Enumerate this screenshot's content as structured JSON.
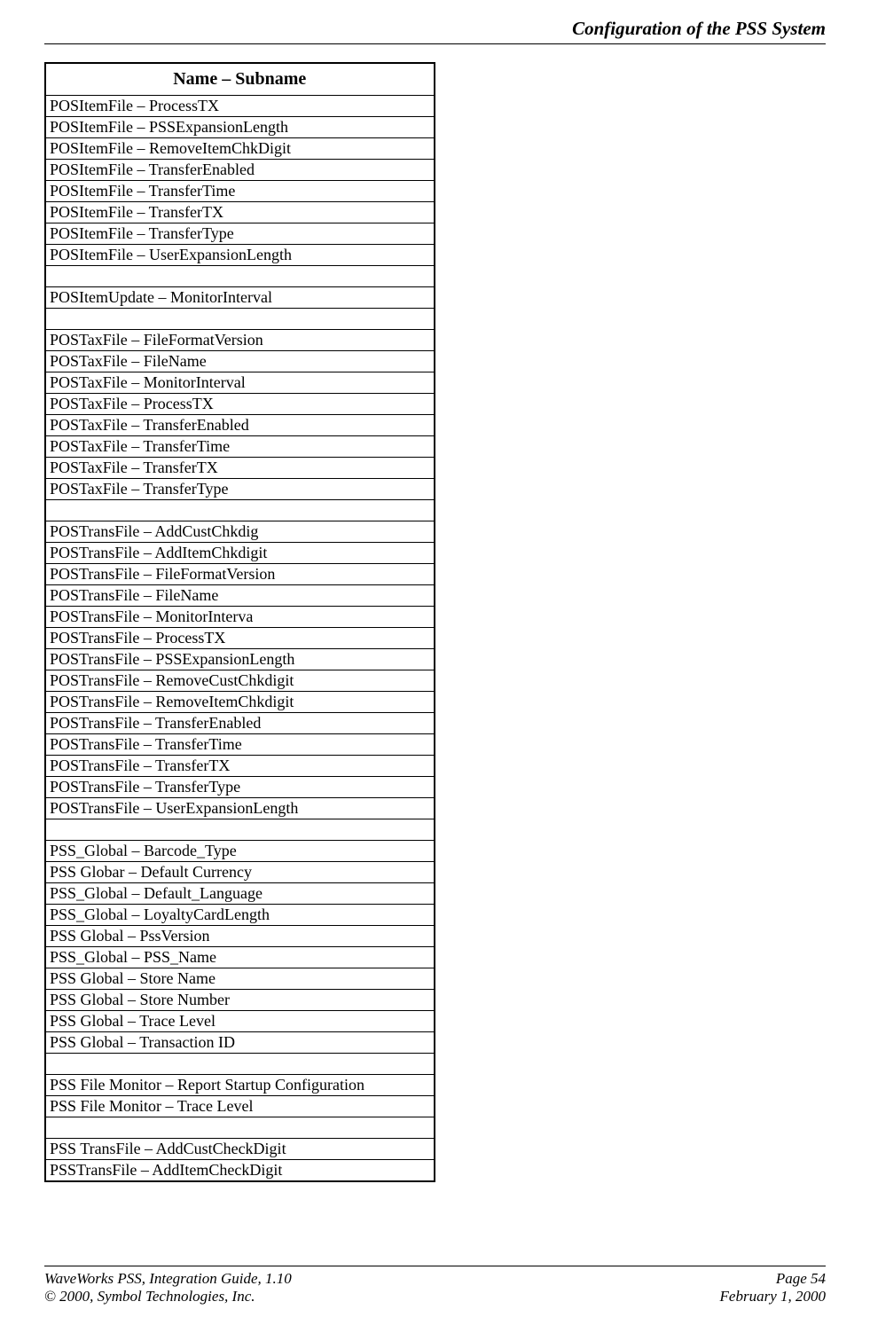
{
  "header": {
    "title": "Configuration of the PSS System"
  },
  "table": {
    "header": "Name – Subname",
    "rows": [
      "POSItemFile – ProcessTX",
      "POSItemFile – PSSExpansionLength",
      "POSItemFile – RemoveItemChkDigit",
      "POSItemFile – TransferEnabled",
      "POSItemFile – TransferTime",
      "POSItemFile – TransferTX",
      "POSItemFile – TransferType",
      "POSItemFile – UserExpansionLength",
      "",
      "POSItemUpdate – MonitorInterval",
      "",
      "POSTaxFile – FileFormatVersion",
      "POSTaxFile – FileName",
      "POSTaxFile – MonitorInterval",
      "POSTaxFile – ProcessTX",
      "POSTaxFile – TransferEnabled",
      "POSTaxFile – TransferTime",
      "POSTaxFile – TransferTX",
      "POSTaxFile – TransferType",
      "",
      "POSTransFile – AddCustChkdig",
      "POSTransFile – AddItemChkdigit",
      "POSTransFile – FileFormatVersion",
      "POSTransFile – FileName",
      "POSTransFile – MonitorInterva",
      "POSTransFile – ProcessTX",
      "POSTransFile – PSSExpansionLength",
      "POSTransFile – RemoveCustChkdigit",
      "POSTransFile – RemoveItemChkdigit",
      "POSTransFile – TransferEnabled",
      "POSTransFile – TransferTime",
      "POSTransFile – TransferTX",
      "POSTransFile – TransferType",
      "POSTransFile – UserExpansionLength",
      "",
      "PSS_Global – Barcode_Type",
      "PSS Globar – Default Currency",
      "PSS_Global – Default_Language",
      "PSS_Global – LoyaltyCardLength",
      "PSS Global – PssVersion",
      "PSS_Global – PSS_Name",
      "PSS Global – Store Name",
      "PSS Global – Store Number",
      "PSS Global – Trace Level",
      "PSS Global – Transaction ID",
      "",
      "PSS File Monitor – Report Startup Configuration",
      "PSS File Monitor – Trace Level",
      "",
      "PSS TransFile – AddCustCheckDigit",
      "PSSTransFile – AddItemCheckDigit"
    ]
  },
  "footer": {
    "left1": "WaveWorks PSS, Integration Guide, 1.10",
    "right1": "Page 54",
    "left2": "© 2000, Symbol Technologies, Inc.",
    "right2": "February 1, 2000"
  }
}
